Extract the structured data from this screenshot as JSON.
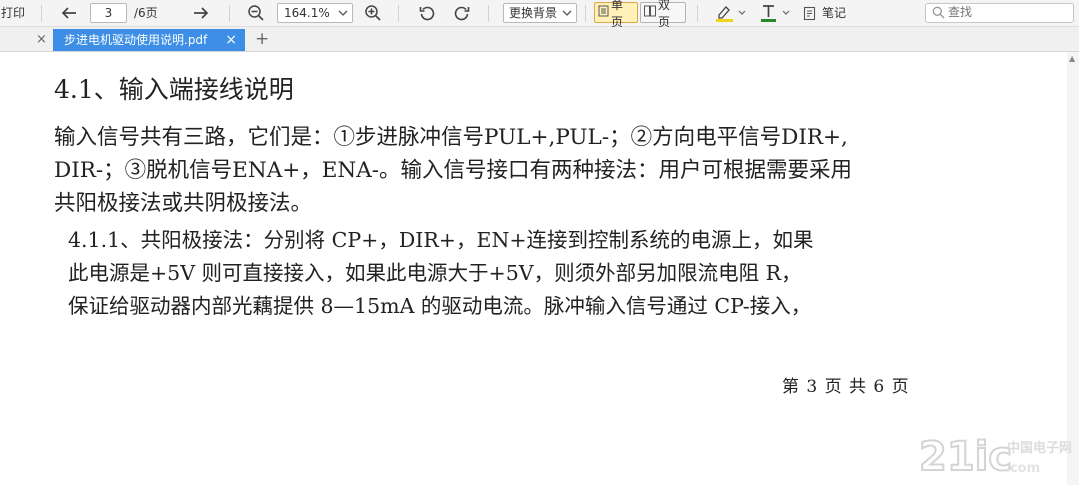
{
  "toolbar": {
    "print_label": "打印",
    "page_current": "3",
    "page_total": "/6页",
    "zoom": "164.1%",
    "bg_label": "更换背景",
    "single_page": "单页",
    "double_page": "双页",
    "notes": "笔记",
    "search_placeholder": "查找",
    "icons": [
      "arrow-left-icon",
      "arrow-right-icon",
      "zoom-out-icon",
      "zoom-in-icon",
      "rotate-left-icon",
      "rotate-right-icon",
      "highlighter-icon",
      "text-color-icon",
      "notes-icon",
      "search-icon"
    ],
    "colors": {
      "highlight": "#f2d21b",
      "text_color_bar": "#2a8a2a",
      "active_tab": "#3c8ee6"
    }
  },
  "tabs": {
    "file_name": "步进电机驱动使用说明.pdf",
    "close": "×",
    "new_tab": "+"
  },
  "document": {
    "heading": "4.1、输入端接线说明",
    "paragraph": [
      "输入信号共有三路，它们是：①步进脉冲信号PUL+,PUL-；②方向电平信号DIR+,",
      "DIR-；③脱机信号ENA+，ENA-。输入信号接口有两种接法：用户可根据需要采用",
      "共阳极接法或共阴极接法。"
    ],
    "sub_paragraph": [
      "4.1.1、共阳极接法：分别将 CP+，DIR+，EN+连接到控制系统的电源上，如果",
      "此电源是+5V 则可直接接入，如果此电源大于+5V，则须外部另加限流电阻 R，",
      "保证给驱动器内部光藕提供 8—15mA 的驱动电流。脉冲输入信号通过 CP-接入，"
    ],
    "footer": "第 3 页 共 6 页"
  },
  "watermark": {
    "text": "21ic",
    "sub": "中国电子网"
  }
}
